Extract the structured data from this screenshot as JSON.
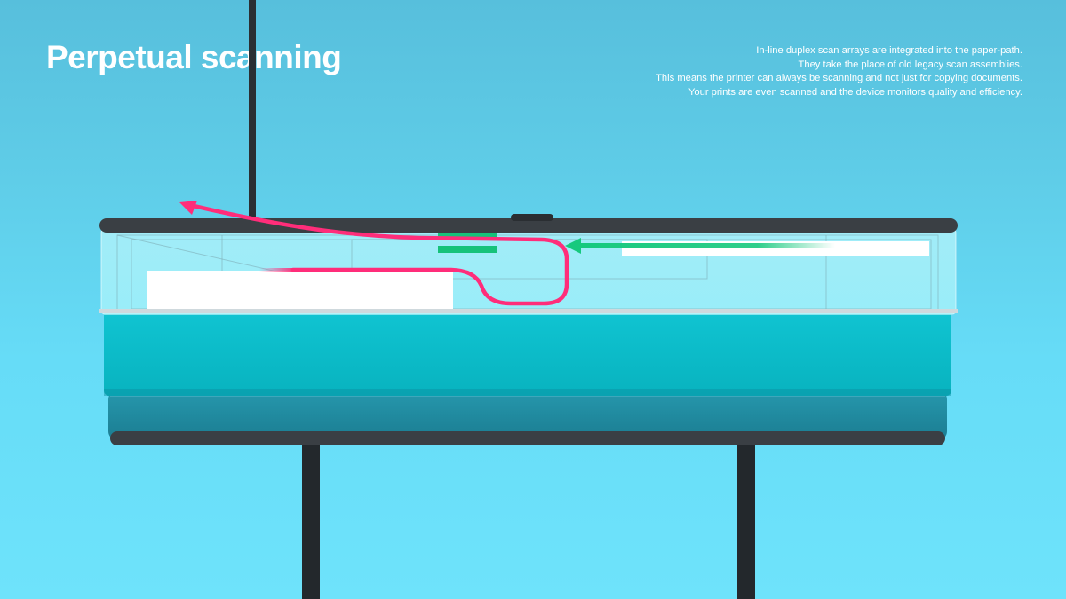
{
  "slide": {
    "title": "Perpetual scanning",
    "description_lines": [
      "In-line duplex scan arrays are integrated into the paper-path.",
      "They take the place of old legacy scan assemblies.",
      "This means the printer can always be scanning and not just for copying documents.",
      "Your prints are even scanned and the device monitors quality and efficiency."
    ]
  },
  "colors": {
    "background": "#66dcf7",
    "paper_path_arrow": "#ff2d7a",
    "scan_array": "#16c27a",
    "scan_arrow": "#17c97e",
    "tray_upper": "#12c3cf",
    "tray_lower": "#1d8fa3",
    "frame": "#3a3f44"
  },
  "icons": {
    "paper_path": "curved-arrow-icon",
    "scan_feed": "arrow-left-icon"
  }
}
